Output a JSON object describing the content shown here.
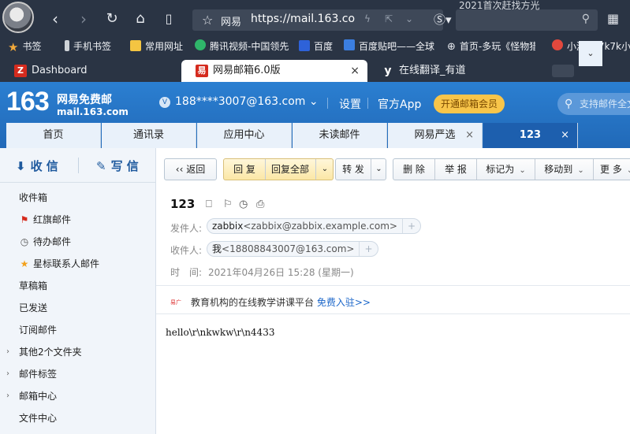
{
  "browser": {
    "search_top_text": "2021首次赶找方光",
    "address": {
      "site_label": "网易",
      "url": "https://mail.163.co"
    },
    "bookmarks": [
      {
        "label": "书签",
        "icon": "star-icon",
        "color": "#f2a93b"
      },
      {
        "label": "手机书签",
        "icon": "phone-icon",
        "color": "#cfd3d8"
      },
      {
        "label": "常用网址",
        "icon": "folder-icon",
        "color": "#f4c542"
      },
      {
        "label": "腾讯视频-中国领先",
        "icon": "tencent-video-icon",
        "color": "#2fb56a"
      },
      {
        "label": "百度",
        "icon": "baidu-paw-icon",
        "color": "#2e62d9"
      },
      {
        "label": "百度贴吧——全球",
        "icon": "tieba-icon",
        "color": "#3b7ee0"
      },
      {
        "label": "首页-多玩《怪物猎",
        "icon": "globe-icon",
        "color": "#cfd3d8"
      },
      {
        "label": "小游戏,7k7k小",
        "icon": "balloon-icon",
        "color": "#e2483d"
      }
    ],
    "tabs": [
      {
        "label": "Dashboard",
        "icon_letter": "Z",
        "icon_color": "#d52b1e",
        "active": false
      },
      {
        "label": "网易邮箱6.0版",
        "icon_letter": "易",
        "icon_color": "#d52b1e",
        "active": true,
        "close": "×"
      },
      {
        "label": "在线翻译_有道",
        "icon_letter": "y",
        "icon_color": "#2a3444",
        "active": false
      }
    ]
  },
  "mail": {
    "logo_number": "163",
    "logo_title": "网易免费邮",
    "logo_domain": "mail.163.com",
    "account": "188****3007@163.com",
    "account_caret": "⌄",
    "settings": "设置",
    "app": "官方App",
    "vip": "开通邮箱会员",
    "search_placeholder": "支持邮件全文",
    "nav_tabs": [
      {
        "label": "首页",
        "active": false
      },
      {
        "label": "通讯录",
        "active": false
      },
      {
        "label": "应用中心",
        "active": false
      },
      {
        "label": "未读邮件",
        "active": false
      },
      {
        "label": "网易严选",
        "active": false,
        "close": "×"
      },
      {
        "label": "123",
        "active": true,
        "close": "×"
      }
    ],
    "nav_more": "⌄"
  },
  "sidebar": {
    "receive": "收 信",
    "compose": "写 信",
    "folders": [
      {
        "label": "收件箱",
        "icon": ""
      },
      {
        "label": "红旗邮件",
        "icon": "red-flag-icon"
      },
      {
        "label": "待办邮件",
        "icon": "clock-icon"
      },
      {
        "label": "星标联系人邮件",
        "icon": "star-icon"
      },
      {
        "label": "草稿箱",
        "icon": ""
      },
      {
        "label": "已发送",
        "icon": ""
      },
      {
        "label": "订阅邮件",
        "icon": ""
      },
      {
        "label": "其他2个文件夹",
        "icon": "",
        "expandable": true
      },
      {
        "label": "邮件标签",
        "icon": "",
        "expandable": true
      },
      {
        "label": "邮箱中心",
        "icon": "",
        "expandable": true
      },
      {
        "label": "文件中心",
        "icon": ""
      }
    ]
  },
  "toolbar": {
    "back": "返回",
    "reply": "回 复",
    "reply_all": "回复全部",
    "forward": "转 发",
    "delete": "删 除",
    "report": "举 报",
    "mark_as": "标记为",
    "move_to": "移动到",
    "more": "更 多"
  },
  "message": {
    "subject": "123",
    "from_label": "发件人:",
    "from_name": "zabbix",
    "from_addr": "<zabbix@zabbix.example.com>",
    "to_label": "收件人:",
    "to_name": "我",
    "to_addr": "<18808843007@163.com>",
    "time_label": "时　间:",
    "time_value": "2021年04月26日 15:28 (星期一)",
    "promo_text": "教育机构的在线教学讲课平台",
    "promo_link": "免费入驻>>",
    "body": "hello\\r\\nkwkw\\r\\n4433"
  }
}
